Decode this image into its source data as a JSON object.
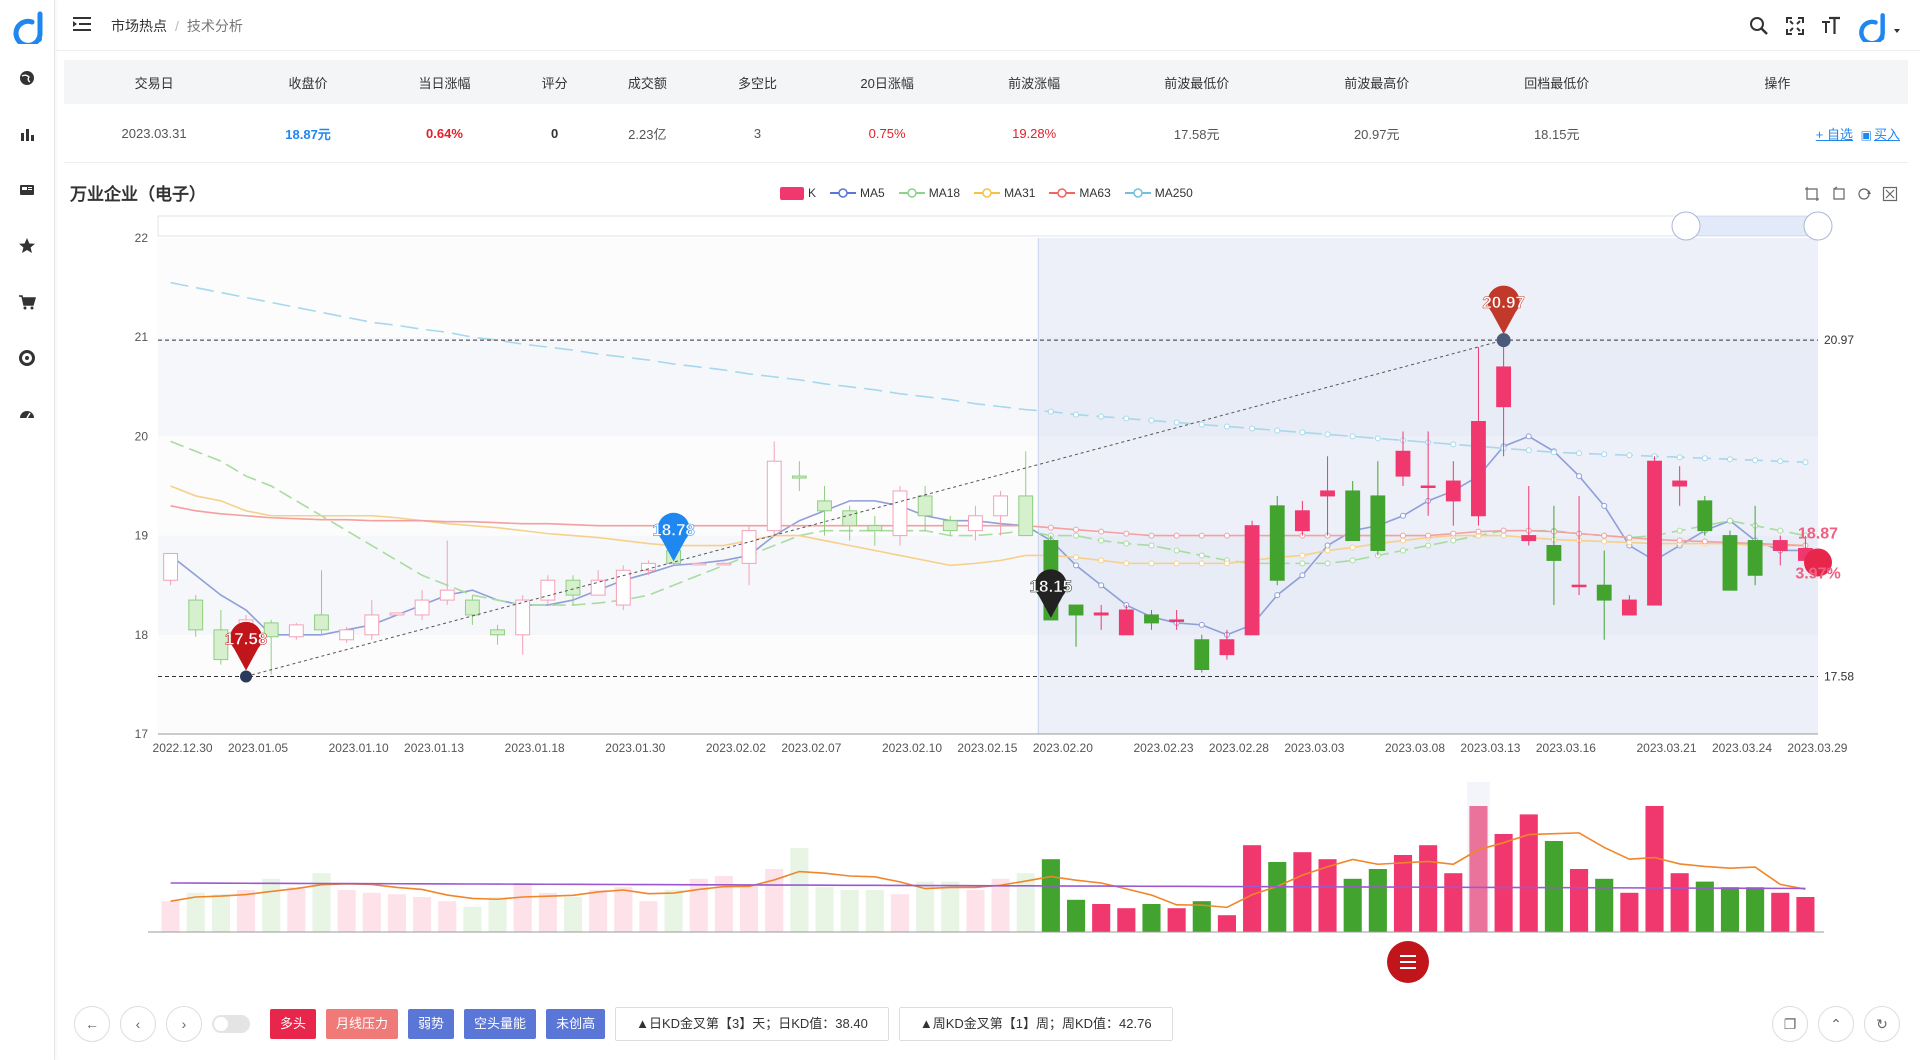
{
  "breadcrumb": {
    "root": "市场热点",
    "sep": "/",
    "current": "技术分析"
  },
  "table": {
    "headers": [
      "交易日",
      "收盘价",
      "当日涨幅",
      "评分",
      "成交额",
      "多空比",
      "20日涨幅",
      "前波涨幅",
      "前波最低价",
      "前波最高价",
      "回档最低价",
      "操作"
    ],
    "row": {
      "date": "2023.03.31",
      "close": "18.87元",
      "change": "0.64%",
      "score": "0",
      "amount": "2.23亿",
      "ratio": "3",
      "chg20": "0.75%",
      "wave_chg": "19.28%",
      "wave_low": "17.58元",
      "wave_high": "20.97元",
      "pullback_low": "18.15元",
      "op_add": "+ 自选",
      "op_buy": "买入"
    }
  },
  "chart": {
    "title": "万业企业（电子）",
    "legend": [
      "K",
      "MA5",
      "MA18",
      "MA31",
      "MA63",
      "MA250"
    ],
    "y_ticks": [
      "22",
      "21",
      "20",
      "19",
      "18",
      "17"
    ],
    "x_ticks": [
      "2022.12.30",
      "2023.01.05",
      "2023.01.10",
      "2023.01.13",
      "2023.01.18",
      "2023.01.30",
      "2023.02.02",
      "2023.02.07",
      "2023.02.10",
      "2023.02.15",
      "2023.02.20",
      "2023.02.23",
      "2023.02.28",
      "2023.03.03",
      "2023.03.08",
      "2023.03.13",
      "2023.03.16",
      "2023.03.21",
      "2023.03.24",
      "2023.03.29"
    ],
    "markers": {
      "low": "17.58",
      "high": "20.97",
      "blue": "18.78",
      "black": "18.15",
      "last": "18.87",
      "last_pct": "3.97%"
    },
    "right_labels": {
      "high_line": "20.97",
      "low_line": "17.58"
    }
  },
  "chart_data": {
    "type": "candlestick",
    "title": "万业企业（电子）",
    "ylim": [
      17,
      22
    ],
    "series": [
      {
        "name": "K",
        "ohlc": [
          [
            18.55,
            18.82,
            18.5,
            18.8
          ],
          [
            18.35,
            18.05,
            17.98,
            18.4
          ],
          [
            18.05,
            17.75,
            17.7,
            18.25
          ],
          [
            17.88,
            18.15,
            17.85,
            18.2
          ],
          [
            18.12,
            17.98,
            17.6,
            18.15
          ],
          [
            17.98,
            18.1,
            17.95,
            18.12
          ],
          [
            18.2,
            18.05,
            18.0,
            18.65
          ],
          [
            17.95,
            18.05,
            17.92,
            18.08
          ],
          [
            18.0,
            18.2,
            17.95,
            18.35
          ],
          [
            18.2,
            18.22,
            18.2,
            18.22
          ],
          [
            18.2,
            18.35,
            18.15,
            18.45
          ],
          [
            18.35,
            18.45,
            18.3,
            18.95
          ],
          [
            18.35,
            18.2,
            18.1,
            18.4
          ],
          [
            18.05,
            18.0,
            17.9,
            18.1
          ],
          [
            18.0,
            18.35,
            17.8,
            18.4
          ],
          [
            18.35,
            18.55,
            18.3,
            18.6
          ],
          [
            18.55,
            18.4,
            18.3,
            18.6
          ],
          [
            18.4,
            18.55,
            18.4,
            18.65
          ],
          [
            18.3,
            18.65,
            18.25,
            18.7
          ],
          [
            18.65,
            18.72,
            18.6,
            18.75
          ],
          [
            18.85,
            18.72,
            18.7,
            18.92
          ],
          [
            18.72,
            18.72,
            18.7,
            18.73
          ],
          [
            18.72,
            18.72,
            18.7,
            18.73
          ],
          [
            18.72,
            19.05,
            18.5,
            19.1
          ],
          [
            19.05,
            19.75,
            19.0,
            19.95
          ],
          [
            19.6,
            19.58,
            19.45,
            19.75
          ],
          [
            19.35,
            19.25,
            19.0,
            19.5
          ],
          [
            19.25,
            19.1,
            18.95,
            19.3
          ],
          [
            19.1,
            19.05,
            18.9,
            19.2
          ],
          [
            19.0,
            19.45,
            18.9,
            19.5
          ],
          [
            19.4,
            19.2,
            19.05,
            19.5
          ],
          [
            19.15,
            19.05,
            19.0,
            19.2
          ],
          [
            19.05,
            19.2,
            18.95,
            19.3
          ],
          [
            19.2,
            19.4,
            19.0,
            19.45
          ],
          [
            19.4,
            19.0,
            19.0,
            19.85
          ],
          [
            18.95,
            18.15,
            18.15,
            19.0
          ],
          [
            18.3,
            18.2,
            17.88,
            18.3
          ],
          [
            18.2,
            18.22,
            18.05,
            18.3
          ],
          [
            18.0,
            18.25,
            18.0,
            18.3
          ],
          [
            18.2,
            18.12,
            18.05,
            18.25
          ],
          [
            18.15,
            18.15,
            18.05,
            18.25
          ],
          [
            17.95,
            17.65,
            17.62,
            18.0
          ],
          [
            17.8,
            17.95,
            17.75,
            18.05
          ],
          [
            18.0,
            19.1,
            18.0,
            19.15
          ],
          [
            19.3,
            18.55,
            18.5,
            19.4
          ],
          [
            19.05,
            19.25,
            19.0,
            19.35
          ],
          [
            19.4,
            19.45,
            19.0,
            19.8
          ],
          [
            19.45,
            18.95,
            18.95,
            19.55
          ],
          [
            19.4,
            18.85,
            18.8,
            19.75
          ],
          [
            19.6,
            19.85,
            19.5,
            20.05
          ],
          [
            19.5,
            19.5,
            19.2,
            20.05
          ],
          [
            19.35,
            19.55,
            19.1,
            19.75
          ],
          [
            19.2,
            20.15,
            19.1,
            20.9
          ],
          [
            20.3,
            20.7,
            19.8,
            20.97
          ],
          [
            18.95,
            19.0,
            18.9,
            19.5
          ],
          [
            18.9,
            18.75,
            18.3,
            19.3
          ],
          [
            18.5,
            18.5,
            18.4,
            19.4
          ],
          [
            18.5,
            18.35,
            17.95,
            18.85
          ],
          [
            18.2,
            18.35,
            18.3,
            18.4
          ],
          [
            18.3,
            19.75,
            18.3,
            19.8
          ],
          [
            19.5,
            19.55,
            19.3,
            19.7
          ],
          [
            19.35,
            19.05,
            19.0,
            19.4
          ],
          [
            19.0,
            18.45,
            18.45,
            19.05
          ],
          [
            18.95,
            18.6,
            18.5,
            19.3
          ],
          [
            18.85,
            18.95,
            18.7,
            19.0
          ],
          [
            18.75,
            18.87,
            18.7,
            19.0
          ]
        ]
      },
      {
        "name": "MA5",
        "values": [
          18.8,
          18.6,
          18.4,
          18.25,
          18.0,
          18.0,
          18.0,
          18.05,
          18.1,
          18.2,
          18.3,
          18.4,
          18.45,
          18.35,
          18.3,
          18.3,
          18.35,
          18.45,
          18.55,
          18.62,
          18.7,
          18.72,
          18.75,
          18.8,
          19.0,
          19.15,
          19.25,
          19.35,
          19.35,
          19.3,
          19.2,
          19.15,
          19.15,
          19.12,
          19.1,
          18.95,
          18.7,
          18.5,
          18.3,
          18.18,
          18.12,
          18.1,
          18.0,
          18.1,
          18.4,
          18.6,
          18.9,
          19.05,
          19.1,
          19.2,
          19.35,
          19.45,
          19.6,
          19.9,
          20.0,
          19.85,
          19.6,
          19.3,
          18.9,
          18.75,
          18.9,
          19.05,
          19.15,
          18.95,
          18.85,
          18.85
        ]
      },
      {
        "name": "MA18",
        "values": [
          19.95,
          19.85,
          19.75,
          19.6,
          19.5,
          19.35,
          19.2,
          19.05,
          18.9,
          18.75,
          18.6,
          18.5,
          18.4,
          18.35,
          18.3,
          18.3,
          18.3,
          18.32,
          18.35,
          18.4,
          18.5,
          18.6,
          18.7,
          18.8,
          18.9,
          19.0,
          19.05,
          19.05,
          19.05,
          19.05,
          19.05,
          19.0,
          19.0,
          19.02,
          19.05,
          19.0,
          19.0,
          18.95,
          18.92,
          18.9,
          18.85,
          18.8,
          18.75,
          18.72,
          18.72,
          18.72,
          18.72,
          18.75,
          18.8,
          18.85,
          18.9,
          18.95,
          19.0,
          19.05,
          19.05,
          19.05,
          19.02,
          19.0,
          18.98,
          19.0,
          19.05,
          19.1,
          19.15,
          19.1,
          19.05,
          19.0
        ]
      },
      {
        "name": "MA31",
        "values": [
          19.5,
          19.4,
          19.35,
          19.25,
          19.2,
          19.2,
          19.2,
          19.2,
          19.2,
          19.18,
          19.15,
          19.12,
          19.1,
          19.08,
          19.05,
          19.02,
          19.0,
          18.98,
          18.95,
          18.92,
          18.9,
          18.9,
          18.9,
          18.95,
          19.0,
          19.0,
          18.95,
          18.9,
          18.85,
          18.8,
          18.75,
          18.7,
          18.72,
          18.75,
          18.8,
          18.8,
          18.78,
          18.75,
          18.72,
          18.72,
          18.72,
          18.72,
          18.72,
          18.75,
          18.78,
          18.8,
          18.85,
          18.88,
          18.92,
          18.95,
          18.98,
          19.0,
          19.0,
          19.0,
          18.98,
          18.96,
          18.95,
          18.94,
          18.93,
          18.92,
          18.92,
          18.92,
          18.92,
          18.9,
          18.9,
          18.9
        ]
      },
      {
        "name": "MA63",
        "values": [
          19.3,
          19.25,
          19.22,
          19.2,
          19.18,
          19.17,
          19.16,
          19.16,
          19.15,
          19.15,
          19.15,
          19.14,
          19.14,
          19.13,
          19.12,
          19.12,
          19.11,
          19.1,
          19.1,
          19.1,
          19.1,
          19.1,
          19.1,
          19.1,
          19.1,
          19.1,
          19.1,
          19.1,
          19.1,
          19.1,
          19.1,
          19.1,
          19.1,
          19.1,
          19.1,
          19.08,
          19.06,
          19.04,
          19.02,
          19.0,
          19.0,
          19.0,
          19.0,
          19.0,
          19.0,
          19.0,
          19.0,
          19.0,
          19.0,
          19.0,
          19.0,
          19.02,
          19.04,
          19.05,
          19.05,
          19.04,
          19.02,
          19.0,
          18.98,
          18.96,
          18.95,
          18.94,
          18.93,
          18.92,
          18.91,
          18.9
        ]
      },
      {
        "name": "MA250",
        "values": [
          21.55,
          21.5,
          21.45,
          21.4,
          21.35,
          21.3,
          21.25,
          21.2,
          21.15,
          21.12,
          21.08,
          21.05,
          21.0,
          20.97,
          20.93,
          20.9,
          20.87,
          20.83,
          20.8,
          20.77,
          20.73,
          20.7,
          20.67,
          20.63,
          20.6,
          20.57,
          20.53,
          20.5,
          20.47,
          20.43,
          20.4,
          20.37,
          20.33,
          20.3,
          20.27,
          20.25,
          20.22,
          20.2,
          20.18,
          20.16,
          20.14,
          20.12,
          20.1,
          20.08,
          20.06,
          20.04,
          20.02,
          20.0,
          19.98,
          19.96,
          19.94,
          19.92,
          19.9,
          19.88,
          19.86,
          19.84,
          19.83,
          19.82,
          19.81,
          19.8,
          19.79,
          19.78,
          19.77,
          19.76,
          19.75,
          19.74
        ]
      }
    ],
    "volume": [
      0.22,
      0.28,
      0.27,
      0.3,
      0.38,
      0.32,
      0.42,
      0.3,
      0.28,
      0.27,
      0.25,
      0.22,
      0.18,
      0.25,
      0.35,
      0.28,
      0.25,
      0.3,
      0.32,
      0.22,
      0.3,
      0.38,
      0.4,
      0.33,
      0.45,
      0.6,
      0.32,
      0.3,
      0.3,
      0.27,
      0.36,
      0.36,
      0.3,
      0.38,
      0.42,
      0.52,
      0.23,
      0.2,
      0.17,
      0.2,
      0.17,
      0.22,
      0.12,
      0.62,
      0.5,
      0.57,
      0.52,
      0.38,
      0.45,
      0.55,
      0.62,
      0.42,
      0.9,
      0.7,
      0.84,
      0.65,
      0.45,
      0.38,
      0.28,
      0.9,
      0.42,
      0.36,
      0.32,
      0.32,
      0.28,
      0.25
    ],
    "high": 20.97,
    "low": 17.58,
    "pullback_low": 18.15
  },
  "indicators": {
    "tags": [
      {
        "label": "多头",
        "color": "#e8254b"
      },
      {
        "label": "月线压力",
        "color": "#f07a78"
      },
      {
        "label": "弱势",
        "color": "#5a76d6"
      },
      {
        "label": "空头量能",
        "color": "#5a76d6"
      },
      {
        "label": "未创高",
        "color": "#5a76d6"
      }
    ],
    "kd_day": "▲日KD金叉第【3】天；日KD值：38.40",
    "kd_week": "▲周KD金叉第【1】周；周KD值：42.76"
  },
  "colors": {
    "up": "#f0386e",
    "down": "#43a32f",
    "accent": "#1e87f0"
  }
}
